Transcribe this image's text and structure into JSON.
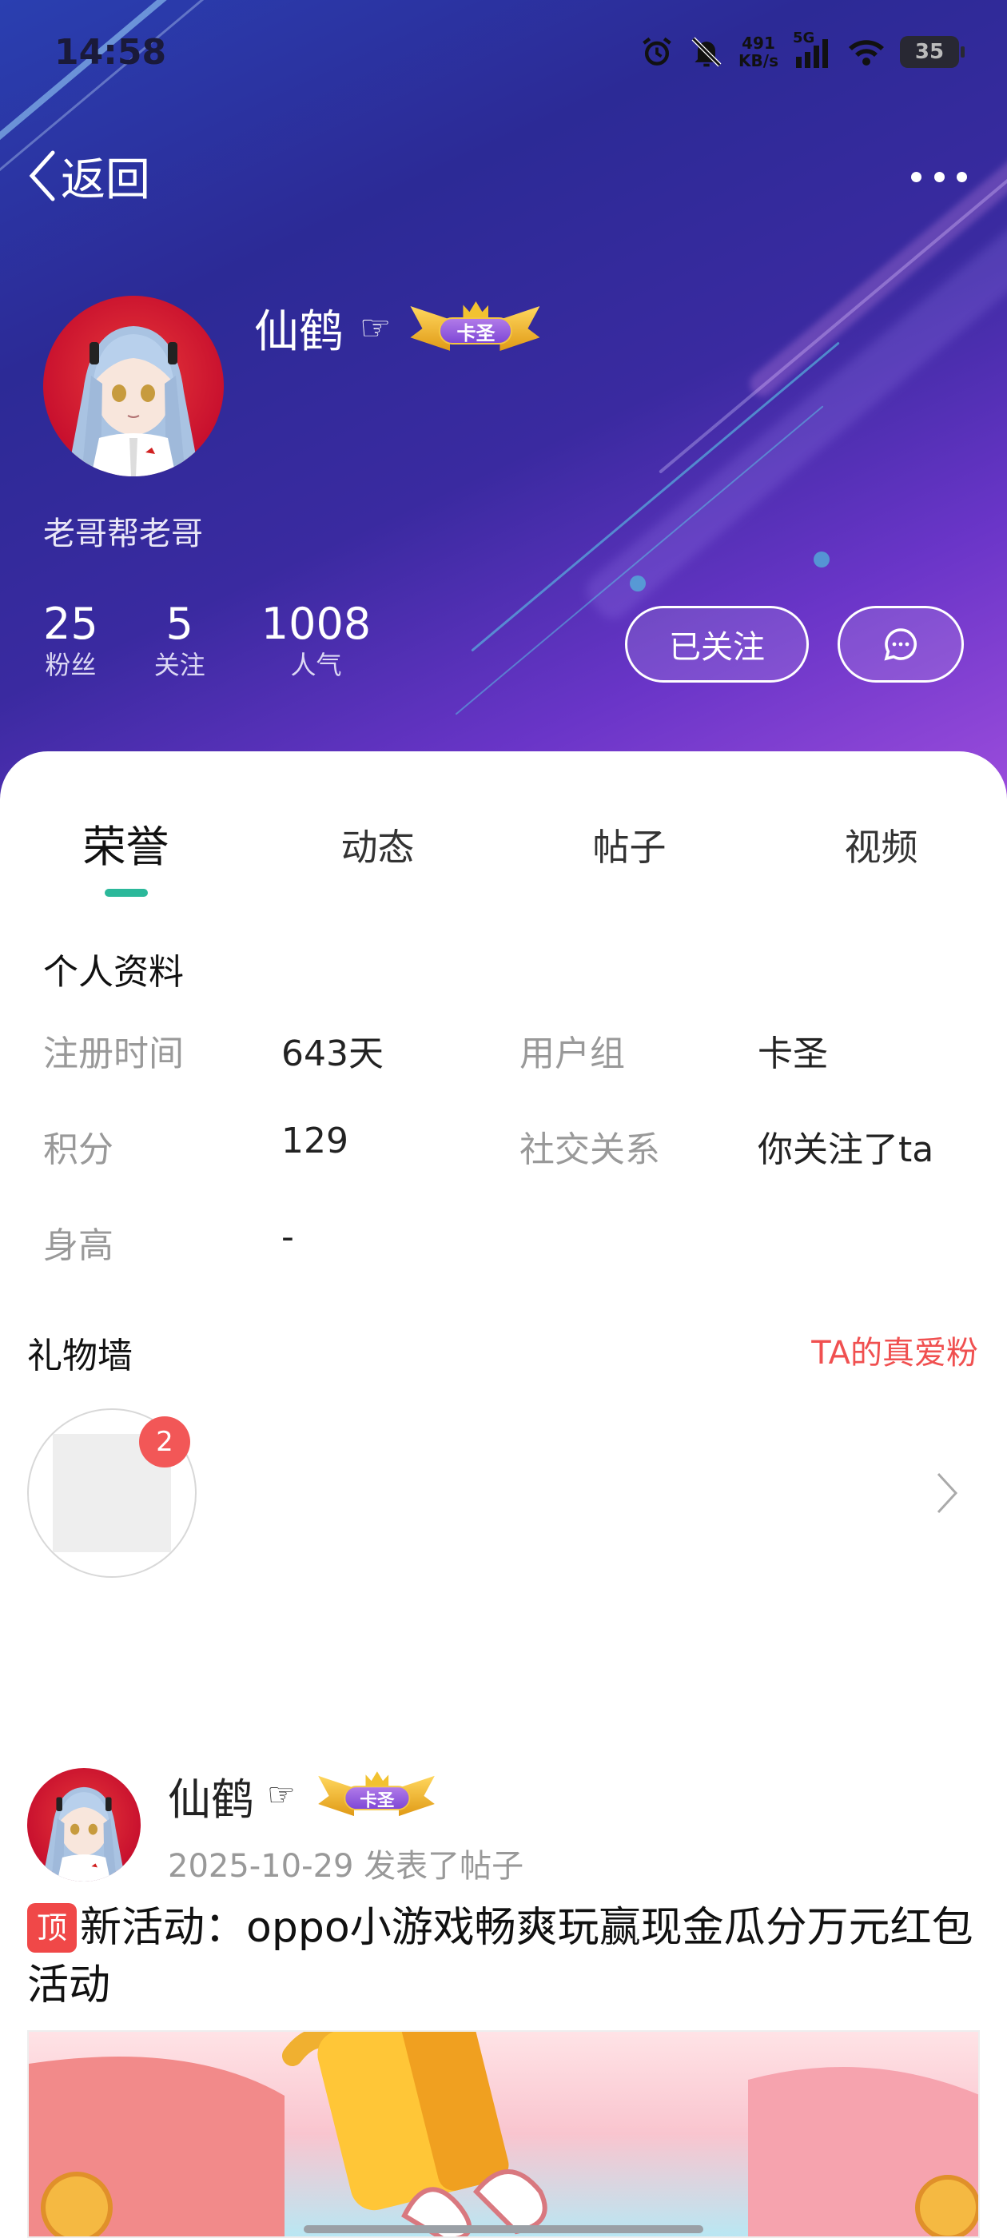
{
  "status_bar": {
    "time": "14:58",
    "net_speed_value": "491",
    "net_speed_unit": "KB/s",
    "signal_label": "5G",
    "battery": "35"
  },
  "nav": {
    "back_label": "返回"
  },
  "profile": {
    "name": "仙鹤",
    "hand_glyph": "☞",
    "badge_label": "卡圣",
    "signature": "老哥帮老哥",
    "stats": [
      {
        "value": "25",
        "label": "粉丝"
      },
      {
        "value": "5",
        "label": "关注"
      },
      {
        "value": "1008",
        "label": "人气"
      }
    ],
    "follow_label": "已关注"
  },
  "tabs": [
    {
      "label": "荣誉",
      "active": true
    },
    {
      "label": "动态",
      "active": false
    },
    {
      "label": "帖子",
      "active": false
    },
    {
      "label": "视频",
      "active": false
    }
  ],
  "personal_info": {
    "title": "个人资料",
    "rows": [
      {
        "label": "注册时间",
        "value": "643天"
      },
      {
        "label": "用户组",
        "value": "卡圣"
      },
      {
        "label": "积分",
        "value": "129"
      },
      {
        "label": "社交关系",
        "value": "你关注了ta"
      },
      {
        "label": "身高",
        "value": "-"
      }
    ]
  },
  "gift_wall": {
    "title": "礼物墙",
    "fans_link": "TA的真爱粉",
    "gift_count": "2"
  },
  "post": {
    "author": "仙鹤",
    "hand_glyph": "☞",
    "badge_label": "卡圣",
    "date": "2025-10-29",
    "action": "发表了帖子",
    "top_tag": "顶",
    "title": "新活动：oppo小游戏畅爽玩赢现金瓜分万元红包活动"
  },
  "colors": {
    "accent": "#2bb89a",
    "link_red": "#f05050",
    "badge_red": "#f25757"
  }
}
